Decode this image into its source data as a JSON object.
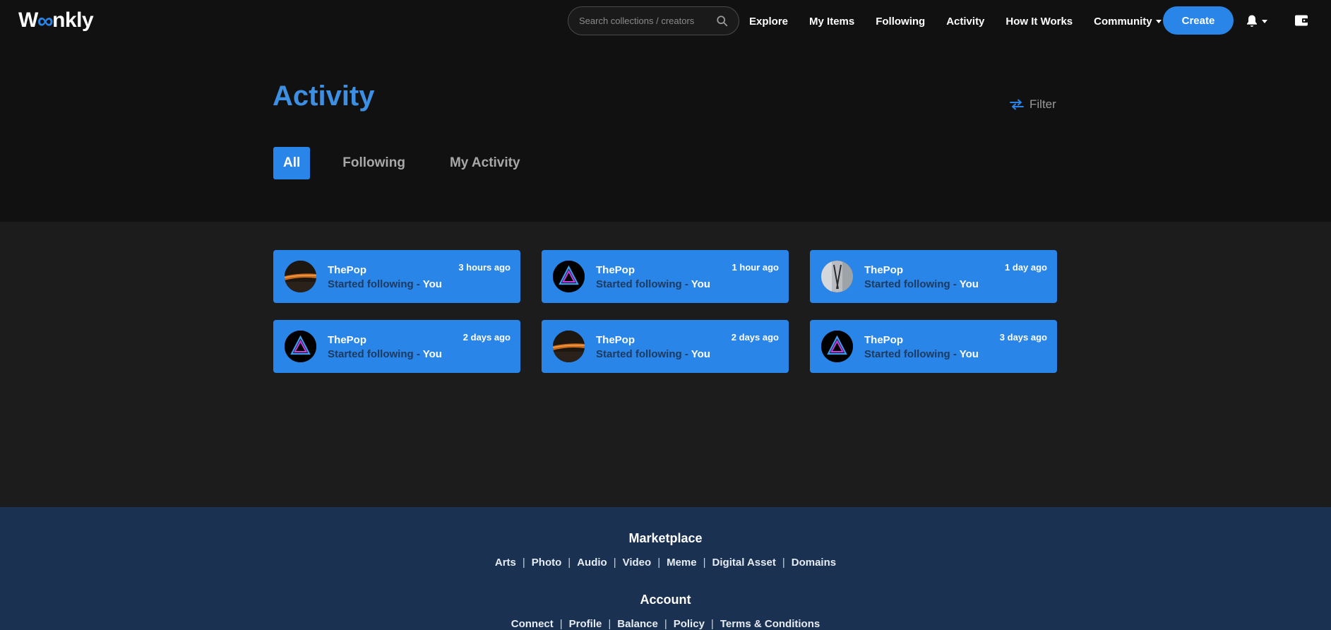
{
  "brand": {
    "logo_left": "W",
    "logo_inf": "∞",
    "logo_right": "nkly"
  },
  "search": {
    "placeholder": "Search collections / creators"
  },
  "nav": {
    "links": [
      "Explore",
      "My Items",
      "Following",
      "Activity",
      "How It Works",
      "Community"
    ],
    "create_label": "Create"
  },
  "page": {
    "title": "Activity",
    "filter_label": "Filter",
    "tabs": [
      "All",
      "Following",
      "My Activity"
    ],
    "active_tab": "All"
  },
  "activity": [
    {
      "user": "ThePop",
      "action": "Started following - ",
      "target": "You",
      "time": "3 hours ago",
      "avatar": "orange-streak"
    },
    {
      "user": "ThePop",
      "action": "Started following - ",
      "target": "You",
      "time": "1 hour ago",
      "avatar": "neon-triangle"
    },
    {
      "user": "ThePop",
      "action": "Started following - ",
      "target": "You",
      "time": "1 day ago",
      "avatar": "grey-photo"
    },
    {
      "user": "ThePop",
      "action": "Started following - ",
      "target": "You",
      "time": "2 days ago",
      "avatar": "neon-triangle"
    },
    {
      "user": "ThePop",
      "action": "Started following - ",
      "target": "You",
      "time": "2 days ago",
      "avatar": "orange-streak"
    },
    {
      "user": "ThePop",
      "action": "Started following - ",
      "target": "You",
      "time": "3 days ago",
      "avatar": "neon-triangle"
    }
  ],
  "footer": {
    "marketplace": {
      "title": "Marketplace",
      "links": [
        "Arts",
        "Photo",
        "Audio",
        "Video",
        "Meme",
        "Digital Asset",
        "Domains"
      ]
    },
    "account": {
      "title": "Account",
      "links": [
        "Connect",
        "Profile",
        "Balance",
        "Policy",
        "Terms & Conditions"
      ]
    }
  },
  "colors": {
    "accent": "#2a85e8",
    "title": "#3d8fe3",
    "background": "#111111",
    "feed_background": "#1c1c1c",
    "footer_background": "#1a3152"
  }
}
